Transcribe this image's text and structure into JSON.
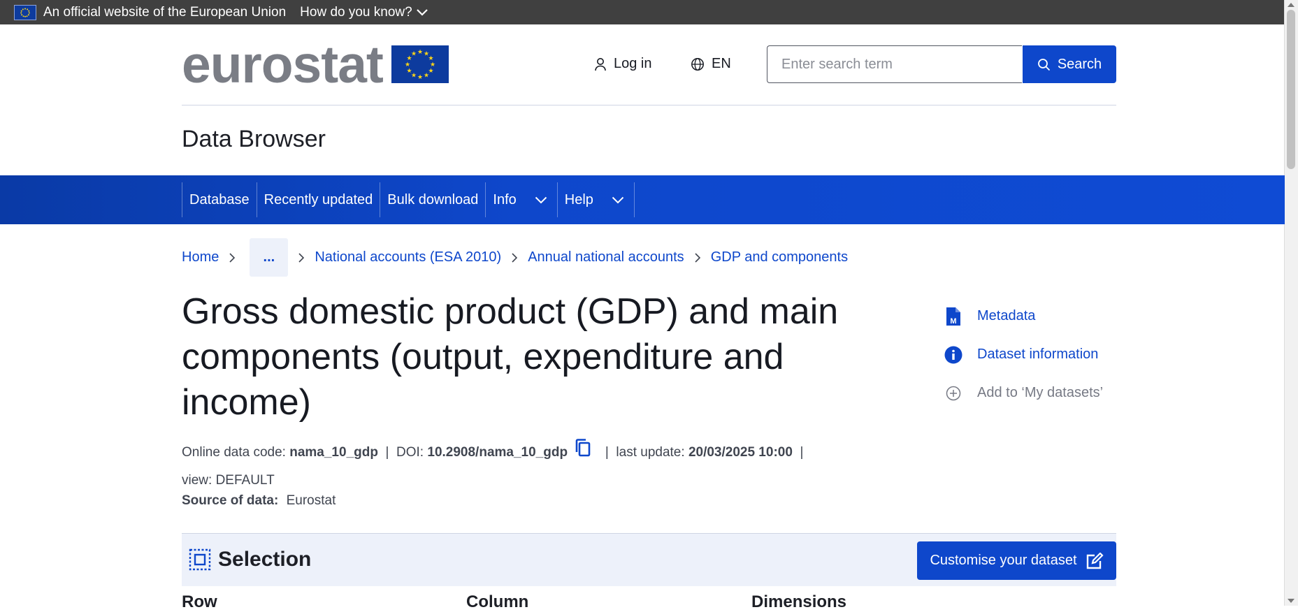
{
  "eu_banner": {
    "official_text": "An official website of the European Union",
    "how_text": "How do you know?"
  },
  "header": {
    "logo_text": "eurostat",
    "login_label": "Log in",
    "language": "EN",
    "search": {
      "placeholder": "Enter search term",
      "value": "",
      "button_label": "Search"
    }
  },
  "site_title": "Data Browser",
  "nav": {
    "items": [
      {
        "label": "Database"
      },
      {
        "label": "Recently updated"
      },
      {
        "label": "Bulk download"
      },
      {
        "label": "Info"
      },
      {
        "label": "Help"
      }
    ]
  },
  "breadcrumb": {
    "home": "Home",
    "ellipsis": "...",
    "items": [
      "National accounts (ESA 2010)",
      "Annual national accounts",
      "GDP and components"
    ]
  },
  "dataset": {
    "title": "Gross domestic product (GDP) and main components (output, expenditure and income)",
    "code_label": "Online data code:",
    "code": "nama_10_gdp",
    "doi_label": "DOI:",
    "doi": "10.2908/nama_10_gdp",
    "update_label": "last update:",
    "update": "20/03/2025 10:00",
    "view": "view: DEFAULT",
    "source_label": "Source of data:",
    "source": "Eurostat"
  },
  "side_links": {
    "metadata": "Metadata",
    "dataset_info": "Dataset information",
    "add_datasets": "Add to ‘My datasets’"
  },
  "selection": {
    "title": "Selection",
    "customise_label": "Customise your dataset",
    "columns": [
      "Row",
      "Column",
      "Dimensions"
    ]
  },
  "colors": {
    "primary": "#0e47cb",
    "eu_bar": "#404040",
    "selection_bg": "#edf1fa"
  }
}
